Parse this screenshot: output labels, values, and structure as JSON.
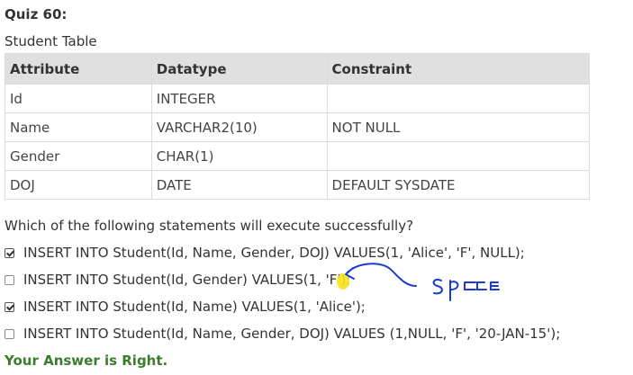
{
  "quiz": {
    "title": "Quiz 60:"
  },
  "table": {
    "caption": "Student Table",
    "headers": [
      "Attribute",
      "Datatype",
      "Constraint"
    ],
    "rows": [
      [
        "Id",
        "INTEGER",
        ""
      ],
      [
        "Name",
        "VARCHAR2(10)",
        "NOT NULL"
      ],
      [
        "Gender",
        "CHAR(1)",
        ""
      ],
      [
        "DOJ",
        "DATE",
        "DEFAULT SYSDATE"
      ]
    ]
  },
  "question": "Which of the following statements will execute successfully?",
  "options": [
    {
      "text": "INSERT INTO Student(Id, Name, Gender, DOJ) VALUES(1, 'Alice', 'F', NULL);",
      "checked": true
    },
    {
      "text": "INSERT INTO Student(Id, Gender) VALUES(1, 'F');",
      "checked": false
    },
    {
      "text": "INSERT INTO Student(Id, Name) VALUES(1, 'Alice');",
      "checked": true
    },
    {
      "text": "INSERT INTO Student(Id, Name, Gender, DOJ) VALUES (1,NULL, 'F', '20-JAN-15');",
      "checked": false
    }
  ],
  "result": "Your Answer is Right.",
  "annotation": {
    "handwritten_word": "space",
    "ink_color": "#1a3ccf",
    "highlight_color": "#f5e61a"
  }
}
